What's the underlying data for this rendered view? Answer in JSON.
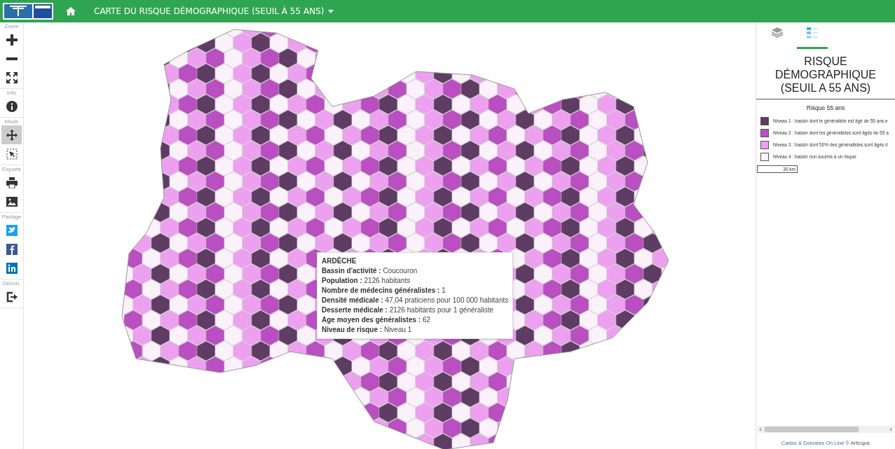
{
  "header": {
    "title": "CARTE DU RISQUE DÉMOGRAPHIQUE (SEUIL À 55 ANS)"
  },
  "toolbar": [
    {
      "label": "Zoom",
      "tools": [
        {
          "kind": "zoom-in",
          "selected": false
        },
        {
          "kind": "zoom-out",
          "selected": false
        },
        {
          "kind": "fullscreen",
          "selected": false
        }
      ]
    },
    {
      "label": "Info",
      "tools": [
        {
          "kind": "info",
          "selected": false
        }
      ]
    },
    {
      "label": "Mode",
      "tools": [
        {
          "kind": "pan",
          "selected": true
        },
        {
          "kind": "select",
          "selected": false
        }
      ]
    },
    {
      "label": "Exports",
      "tools": [
        {
          "kind": "print",
          "selected": false
        },
        {
          "kind": "image",
          "selected": false
        }
      ]
    },
    {
      "label": "Partage",
      "tools": [
        {
          "kind": "twitter",
          "selected": false
        },
        {
          "kind": "facebook",
          "selected": false
        },
        {
          "kind": "linkedin",
          "selected": false
        }
      ]
    },
    {
      "label": "Décon.",
      "tools": [
        {
          "kind": "logout",
          "selected": false
        }
      ]
    }
  ],
  "tooltip": {
    "title": "ARDÈCHE",
    "lines": [
      "**Bassin d'activité :** Coucouron",
      "**Population :** 2126 habitants",
      "**Nombre de médecins généralistes :** 1",
      "**Densité médicale :** 47,04 praticiens pour 100 000 habitants",
      "**Desserte médicale :** 2126 habitants pour 1 généraliste",
      "**Age moyen des généralistes :** 62",
      "**Niveau de risque :** Niveau 1"
    ]
  },
  "panel": {
    "tabs": [
      {
        "kind": "layers",
        "selected": false
      },
      {
        "kind": "legend",
        "selected": true
      }
    ],
    "title": "RISQUE DÉMOGRAPHIQUE (SEUIL A 55 ANS)",
    "legend_title": "Risque 55 ans",
    "legend": [
      {
        "label": "Niveau 1 : bassin dont le généraliste est âgé de 55 ans e",
        "color": "#5e3c63"
      },
      {
        "label": "Niveau 2 : bassin dont les généralistes sont âgés de 55 a",
        "color": "#b94fc0"
      },
      {
        "label": "Niveau 3 : bassin dont 50% des généralistes sont âgés d",
        "color": "#eda0ef"
      },
      {
        "label": "Niveau 4 : bassin non soumis à un risque",
        "color": "#fbf1fb"
      }
    ],
    "scale": "30 km",
    "credit_link": "Cartes & Données On Line",
    "credit_text": "© Articque"
  }
}
